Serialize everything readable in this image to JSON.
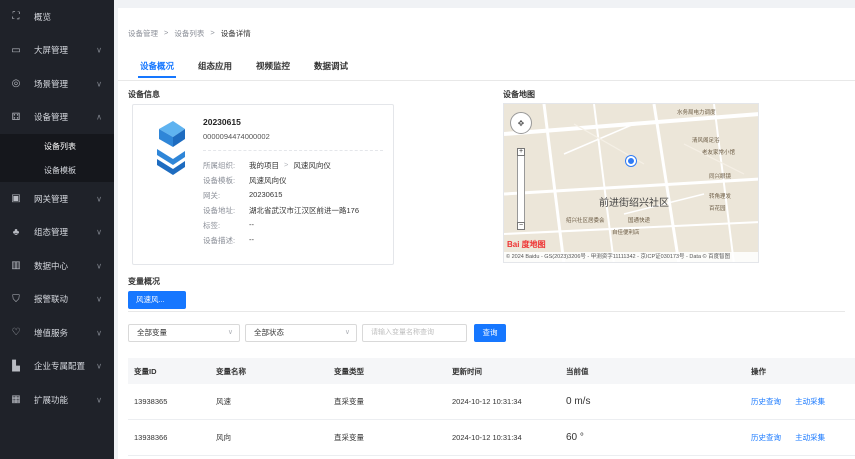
{
  "sidebar": {
    "items": [
      {
        "icon": "overview-icon",
        "label": "概览"
      },
      {
        "icon": "screen-icon",
        "label": "大屏管理",
        "chevron": "∨"
      },
      {
        "icon": "scene-icon",
        "label": "场景管理",
        "chevron": "∨"
      },
      {
        "icon": "device-icon",
        "label": "设备管理",
        "chevron": "∧"
      },
      {
        "icon": "gateway-icon",
        "label": "网关管理",
        "chevron": "∨"
      },
      {
        "icon": "config-icon",
        "label": "组态管理",
        "chevron": "∨"
      },
      {
        "icon": "data-icon",
        "label": "数据中心",
        "chevron": "∨"
      },
      {
        "icon": "alarm-icon",
        "label": "报警联动",
        "chevron": "∨"
      },
      {
        "icon": "service-icon",
        "label": "增值服务",
        "chevron": "∨"
      },
      {
        "icon": "enterprise-icon",
        "label": "企业专属配置",
        "chevron": "∨"
      },
      {
        "icon": "extend-icon",
        "label": "扩展功能",
        "chevron": "∨"
      }
    ],
    "sub_items": [
      {
        "label": "设备列表"
      },
      {
        "label": "设备模板"
      }
    ]
  },
  "breadcrumb": {
    "items": [
      "设备管理",
      "设备列表",
      "设备详情"
    ],
    "sep": ">"
  },
  "tabs": [
    {
      "label": "设备概况"
    },
    {
      "label": "组态应用"
    },
    {
      "label": "视频监控"
    },
    {
      "label": "数据调试"
    }
  ],
  "device_info": {
    "title": "设备信息",
    "name": "20230615",
    "id": "0000094474000002",
    "fields": [
      {
        "key": "所属组织:",
        "value": "我的项目",
        "value2": "风速风向仪",
        "sep": ">"
      },
      {
        "key": "设备模板:",
        "value": "风速风向仪"
      },
      {
        "key": "网关:",
        "value": "20230615"
      },
      {
        "key": "设备地址:",
        "value": "湖北省武汉市江汉区前进一路176"
      },
      {
        "key": "标签:",
        "value": "--"
      },
      {
        "key": "设备描述:",
        "value": "--"
      }
    ]
  },
  "map": {
    "title": "设备地图",
    "area_label": "前进街绍兴社区",
    "pois": [
      "水务局电力调度",
      "清风阁足浴",
      "老友家常小馆",
      "同兴眼镜",
      "转角理发",
      "百花园",
      "绍兴社区居委会",
      "国通快递",
      "自佳便利店"
    ],
    "logo": "Bai 度地图",
    "copyright": "© 2024 Baidu - GS(2023)3206号 - 甲测资字11111342 - 京ICP证030173号 - Data © 百度智图"
  },
  "variables": {
    "title": "变量概况",
    "group_tab": "风速风...",
    "filter_type": "全部变量",
    "filter_status": "全部状态",
    "search_placeholder": "请输入变量名称查询",
    "query_label": "查询",
    "columns": [
      "变量ID",
      "变量名称",
      "变量类型",
      "更新时间",
      "当前值",
      "操作"
    ],
    "rows": [
      {
        "id": "13938365",
        "name": "风速",
        "type": "直采变量",
        "time": "2024-10-12 10:31:34",
        "value": "0 m/s",
        "action1": "历史查询",
        "action2": "主动采集"
      },
      {
        "id": "13938366",
        "name": "风向",
        "type": "直采变量",
        "time": "2024-10-12 10:31:34",
        "value": "60 °",
        "action1": "历史查询",
        "action2": "主动采集"
      }
    ]
  },
  "colors": {
    "accent": "#1677ff",
    "sidebar_bg": "#1f2229"
  }
}
